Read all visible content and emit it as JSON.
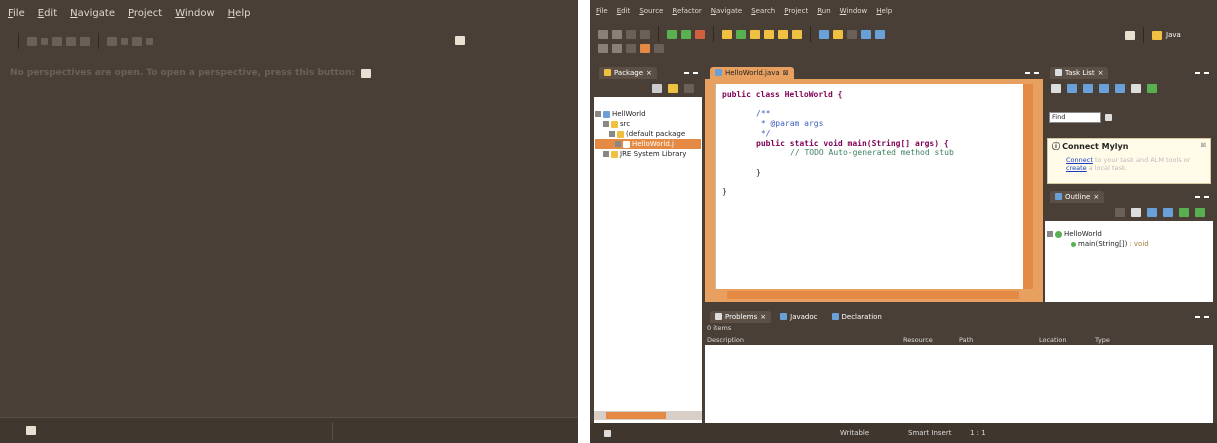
{
  "window1": {
    "menu": [
      "File",
      "Edit",
      "Navigate",
      "Project",
      "Window",
      "Help"
    ],
    "message": "No perspectives are open. To open a perspective, press this button:"
  },
  "window2": {
    "menu": [
      "File",
      "Edit",
      "Source",
      "Refactor",
      "Navigate",
      "Search",
      "Project",
      "Run",
      "Window",
      "Help"
    ],
    "perspective_label": "Java",
    "package_explorer": {
      "tab_label": "Package",
      "tree": [
        "HellWorld",
        "src",
        "(default package",
        "HelloWorld.j",
        "JRE System Library"
      ]
    },
    "editor": {
      "tab_label": "HelloWorld.java",
      "code": {
        "class_decl": "public class HelloWorld {",
        "doc_open": "/**",
        "doc_param": " * @param args",
        "doc_close": " */",
        "method_decl": "public static void main(String[] args) {",
        "todo": "// TODO Auto-generated method stub",
        "close_method": "}",
        "close_class": "}"
      }
    },
    "task_list": {
      "tab_label": "Task List",
      "find_placeholder": "Find"
    },
    "mylyn": {
      "title": "Connect Mylyn",
      "connect_link": "Connect",
      "connect_text": " to your task and ALM tools or",
      "create_link": "create",
      "create_text": " a local task."
    },
    "outline": {
      "tab_label": "Outline",
      "class_item": "HelloWorld",
      "method_item": "main(String[])",
      "method_type": ": void"
    },
    "problems": {
      "tabs": [
        "Problems",
        "Javadoc",
        "Declaration"
      ],
      "items_count": "0 items",
      "columns": [
        "Description",
        "Resource",
        "Path",
        "Location",
        "Type"
      ]
    },
    "status": {
      "writable": "Writable",
      "insert_mode": "Smart Insert",
      "position": "1 : 1"
    }
  }
}
